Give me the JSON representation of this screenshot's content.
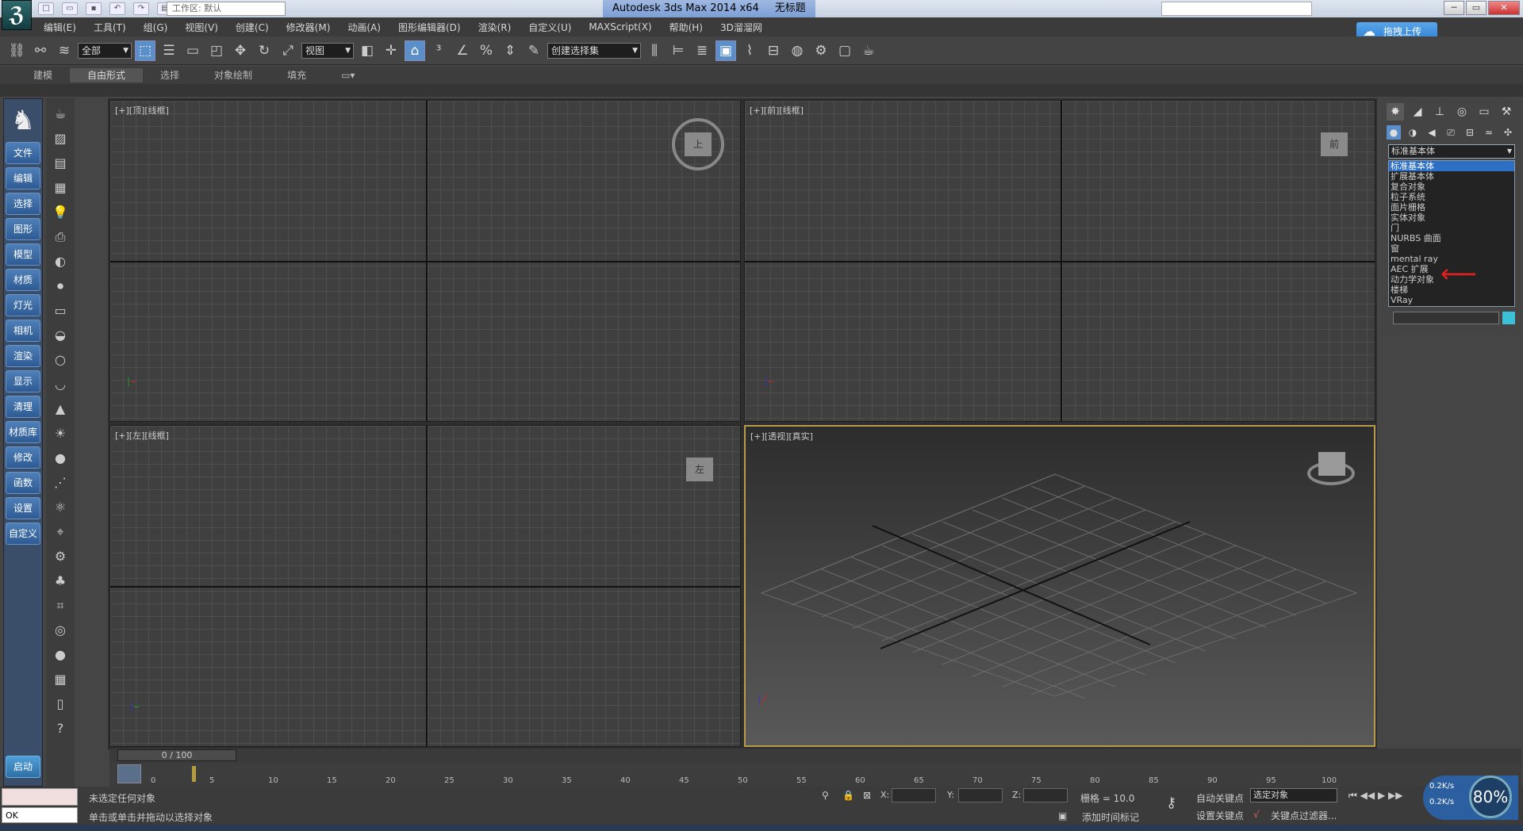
{
  "titlebar": {
    "app_title": "Autodesk 3ds Max  2014 x64",
    "doc_title": "无标题",
    "workspace": "工作区: 默认",
    "app_icon": "3ds-max-logo-icon"
  },
  "window_buttons": {
    "minimize": "─",
    "restore": "▭",
    "close": "✕"
  },
  "menu": {
    "items": [
      "编辑(E)",
      "工具(T)",
      "组(G)",
      "视图(V)",
      "创建(C)",
      "修改器(M)",
      "动画(A)",
      "图形编辑器(D)",
      "渲染(R)",
      "自定义(U)",
      "MAXScript(X)",
      "帮助(H)",
      "3D溜溜网"
    ]
  },
  "upload_button": {
    "label": "拖拽上传",
    "icon": "cloud-icon",
    "color": "#3a8fdf"
  },
  "toolbar": {
    "filter_select": "全部",
    "ref_coord_select": "视图",
    "named_sel_set": "创建选择集"
  },
  "ribbon": {
    "tabs": [
      "建模",
      "自由形式",
      "选择",
      "对象绘制",
      "填充"
    ],
    "active_tab": "自由形式"
  },
  "left_nav": {
    "logo_icon": "deer-icon",
    "items": [
      "文件",
      "编辑",
      "选择",
      "图形",
      "模型",
      "材质",
      "灯光",
      "相机",
      "渲染",
      "显示",
      "清理",
      "材质库",
      "修改",
      "函数",
      "设置",
      "自定义"
    ],
    "start_label": "启动",
    "color": "#3a6fb0"
  },
  "viewports": {
    "top": {
      "label": "[+][顶][线框]",
      "cube_face": "上"
    },
    "front": {
      "label": "[+][前][线框]",
      "cube_face": "前"
    },
    "left": {
      "label": "[+][左][线框]",
      "cube_face": "左"
    },
    "perspective": {
      "label": "[+][透视][真实]"
    }
  },
  "command_panel": {
    "category_select": "标准基本体",
    "category_options": [
      "标准基本体",
      "扩展基本体",
      "复合对象",
      "粒子系统",
      "面片栅格",
      "实体对象",
      "门",
      "NURBS 曲面",
      "窗",
      "mental ray",
      "AEC 扩展",
      "动力学对象",
      "楼梯",
      "VRay"
    ],
    "highlighted_option": "标准基本体",
    "arrow_target": "AEC 扩展",
    "arrow_color": "#e02020",
    "swatch_color": "#3cc0d8"
  },
  "timeline": {
    "slider": "0 / 100",
    "ticks": [
      "0",
      "5",
      "10",
      "15",
      "20",
      "25",
      "30",
      "35",
      "40",
      "45",
      "50",
      "55",
      "60",
      "65",
      "70",
      "75",
      "80",
      "85",
      "90",
      "95",
      "100"
    ]
  },
  "status": {
    "listener_ok": "OK",
    "selection_status": "未选定任何对象",
    "prompt": "单击或单击并拖动以选择对象",
    "x_label": "X:",
    "y_label": "Y:",
    "z_label": "Z:",
    "grid": "栅格 = 10.0",
    "auto_key": "自动关键点",
    "key_mode": "选定对象",
    "set_key": "设置关键点",
    "key_filter": "关键点过滤器...",
    "add_time_tag": "添加时间标记"
  },
  "net_monitor": {
    "up": "0.2K/s",
    "down": "0.2K/s",
    "cpu": "80%"
  }
}
